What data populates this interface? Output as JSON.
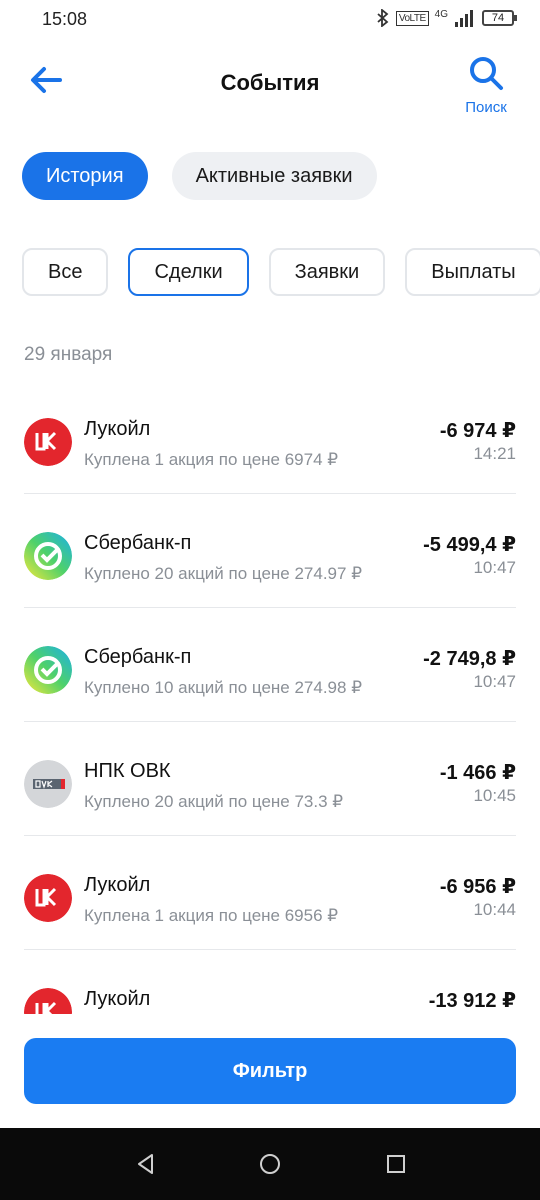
{
  "status_bar": {
    "time": "15:08",
    "volte": "VoLTE",
    "network": "4G",
    "battery": "74"
  },
  "header": {
    "title": "События",
    "search_label": "Поиск",
    "back_icon": "arrow-left-icon",
    "search_icon": "search-icon"
  },
  "tabs": [
    {
      "label": "История",
      "active": true
    },
    {
      "label": "Активные заявки",
      "active": false
    }
  ],
  "filters": [
    {
      "label": "Все",
      "selected": false
    },
    {
      "label": "Сделки",
      "selected": true
    },
    {
      "label": "Заявки",
      "selected": false
    },
    {
      "label": "Выплаты",
      "selected": false
    }
  ],
  "date_header": "29 января",
  "events": [
    {
      "name": "Лукойл",
      "desc": "Куплена 1 акция по цене 6974 ₽",
      "amount": "-6 974 ₽",
      "time": "14:21",
      "logo": "lukoil-logo"
    },
    {
      "name": "Сбербанк-п",
      "desc": "Куплено 20 акций по цене 274.97 ₽",
      "amount": "-5 499,4 ₽",
      "time": "10:47",
      "logo": "sber-logo"
    },
    {
      "name": "Сбербанк-п",
      "desc": "Куплено 10 акций по цене 274.98 ₽",
      "amount": "-2 749,8 ₽",
      "time": "10:47",
      "logo": "sber-logo"
    },
    {
      "name": "НПК ОВК",
      "desc": "Куплено 20 акций по цене 73.3 ₽",
      "amount": "-1 466 ₽",
      "time": "10:45",
      "logo": "ovk-logo"
    },
    {
      "name": "Лукойл",
      "desc": "Куплена 1 акция по цене 6956 ₽",
      "amount": "-6 956 ₽",
      "time": "10:44",
      "logo": "lukoil-logo"
    },
    {
      "name": "Лукойл",
      "desc": "",
      "amount": "-13 912 ₽",
      "time": "",
      "logo": "lukoil-logo"
    }
  ],
  "filter_button": "Фильтр",
  "colors": {
    "accent": "#1a73e8",
    "button": "#1a7cf2",
    "lukoil": "#e3262d",
    "muted": "#8a8f96"
  }
}
